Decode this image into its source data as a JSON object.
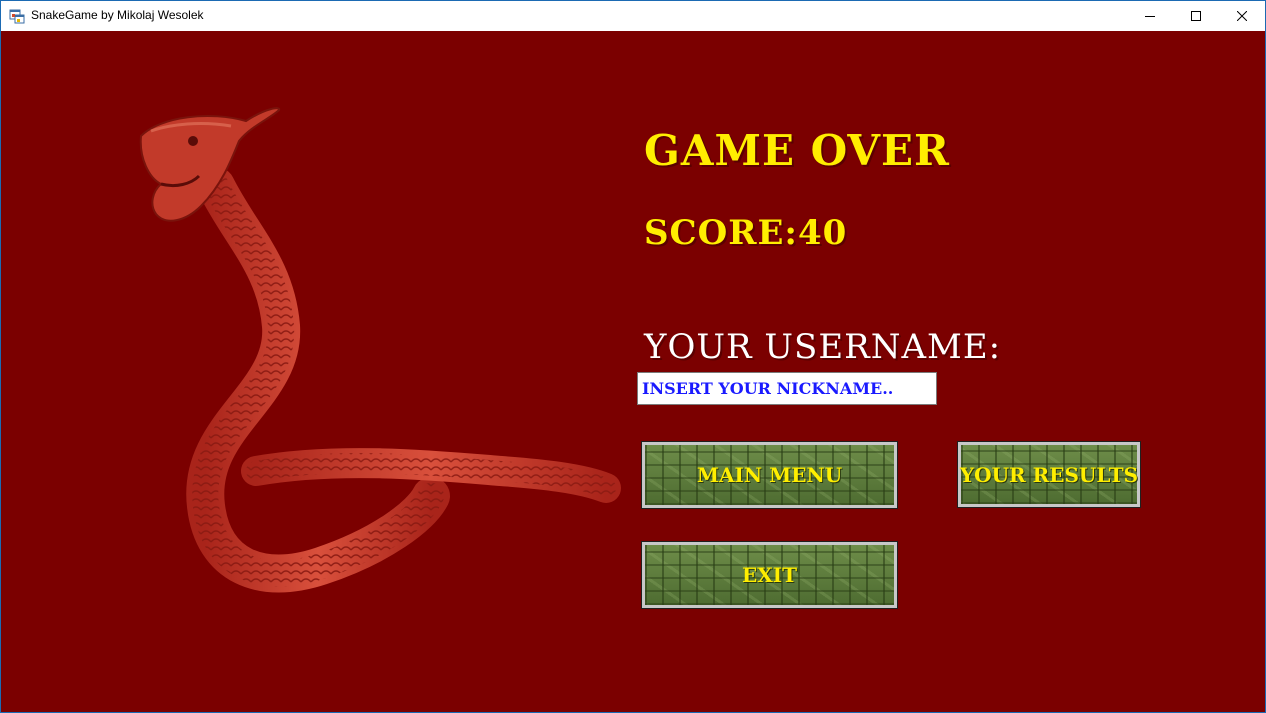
{
  "window": {
    "title": "SnakeGame by Mikolaj Wesolek",
    "controls": {
      "minimize_icon": "minimize-icon",
      "maximize_icon": "maximize-icon",
      "close_icon": "close-icon"
    }
  },
  "colors": {
    "background": "#7b0000",
    "heading_yellow": "#ffee00",
    "label_white": "#ffffff",
    "input_text_blue": "#1a1aff",
    "button_green": "#5b7a3b"
  },
  "game_over": {
    "title": "GAME OVER",
    "score_text": "SCORE:40"
  },
  "username": {
    "label": "YOUR USERNAME:",
    "input_value": "",
    "input_placeholder": "INSERT YOUR NICKNAME.."
  },
  "buttons": {
    "main_menu": "MAIN MENU",
    "your_results": "YOUR RESULTS",
    "exit": "EXIT"
  },
  "decoration": {
    "image": "red-snake-illustration"
  }
}
